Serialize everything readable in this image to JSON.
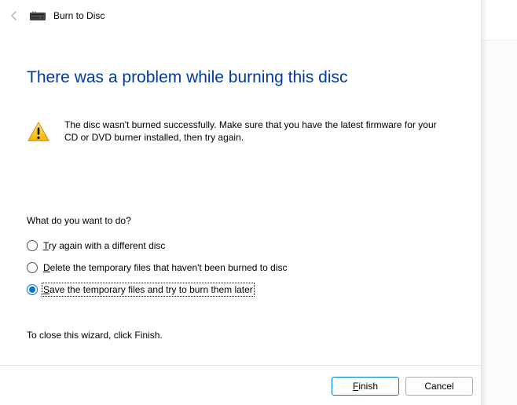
{
  "header": {
    "title": "Burn to Disc"
  },
  "heading": "There was a problem while burning this disc",
  "error_message": "The disc wasn't burned successfully. Make sure that you have the latest firmware for your CD or DVD burner installed, then try again.",
  "prompt": "What do you want to do?",
  "options": {
    "try_again": {
      "label_pre": "",
      "label_mn": "T",
      "label_post": "ry again with a different disc",
      "selected": false
    },
    "delete_temp": {
      "label_pre": "",
      "label_mn": "D",
      "label_post": "elete the temporary files that haven't been burned to disc",
      "selected": false
    },
    "save_temp": {
      "label_pre": "",
      "label_mn": "S",
      "label_post": "ave the temporary files and try to burn them later",
      "selected": true
    }
  },
  "close_hint": "To close this wizard, click Finish.",
  "buttons": {
    "finish_pre": "",
    "finish_mn": "F",
    "finish_post": "inish",
    "cancel": "Cancel"
  }
}
